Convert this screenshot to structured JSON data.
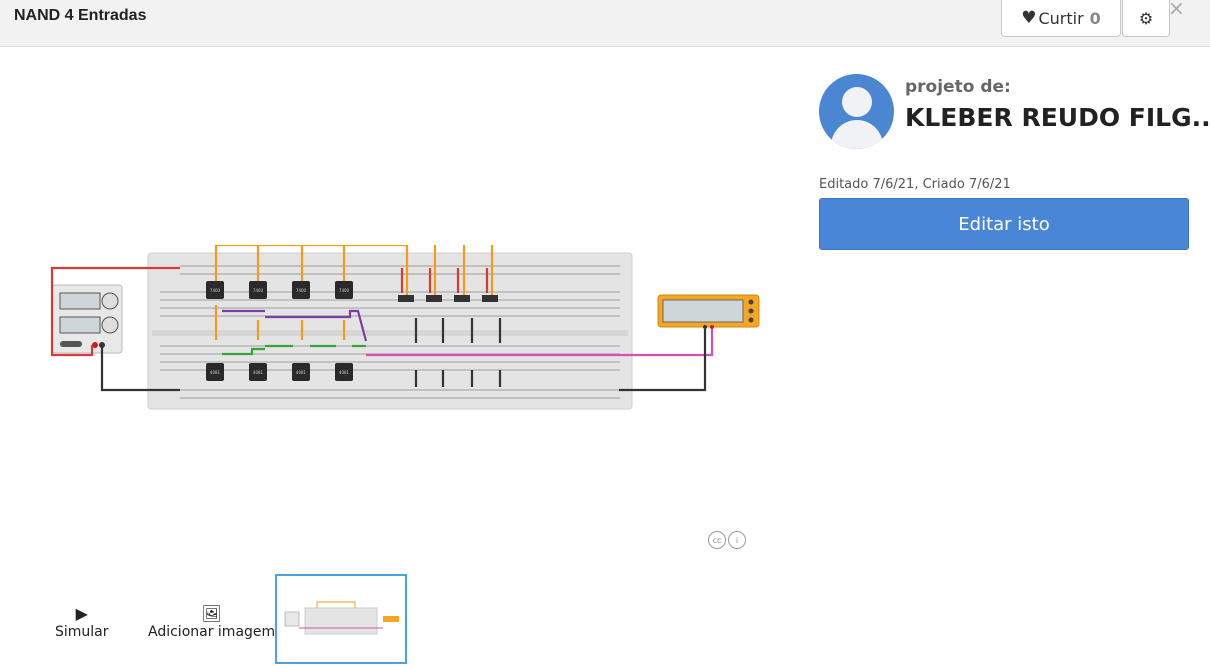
{
  "header": {
    "title": "NAND 4 Entradas",
    "like_label": "Curtir",
    "like_count": "0",
    "icons": [
      "heart-icon",
      "gear-icon",
      "close-icon"
    ]
  },
  "circuit": {
    "ic_upper_label": "7400",
    "ic_lower_label": "4081",
    "component_icons": [
      "power-supply",
      "breadboard",
      "multimeter"
    ]
  },
  "license": {
    "icons": [
      "cc-icon",
      "by-icon"
    ]
  },
  "toolbar": {
    "simulate_label": "Simular",
    "add_image_label": "Adicionar imagem"
  },
  "project": {
    "by_label": "projeto de:",
    "author": "KLEBER REUDO FILG...",
    "dates": "Editado 7/6/21, Criado 7/6/21",
    "edit_label": "Editar isto"
  },
  "colors": {
    "accent": "#4a86d8",
    "wire_orange": "#f29b1d",
    "wire_red": "#d83a3a",
    "wire_purple": "#7b3fa0",
    "wire_green": "#3aa33a",
    "wire_pink": "#d64fb3",
    "multimeter": "#f5a623"
  }
}
